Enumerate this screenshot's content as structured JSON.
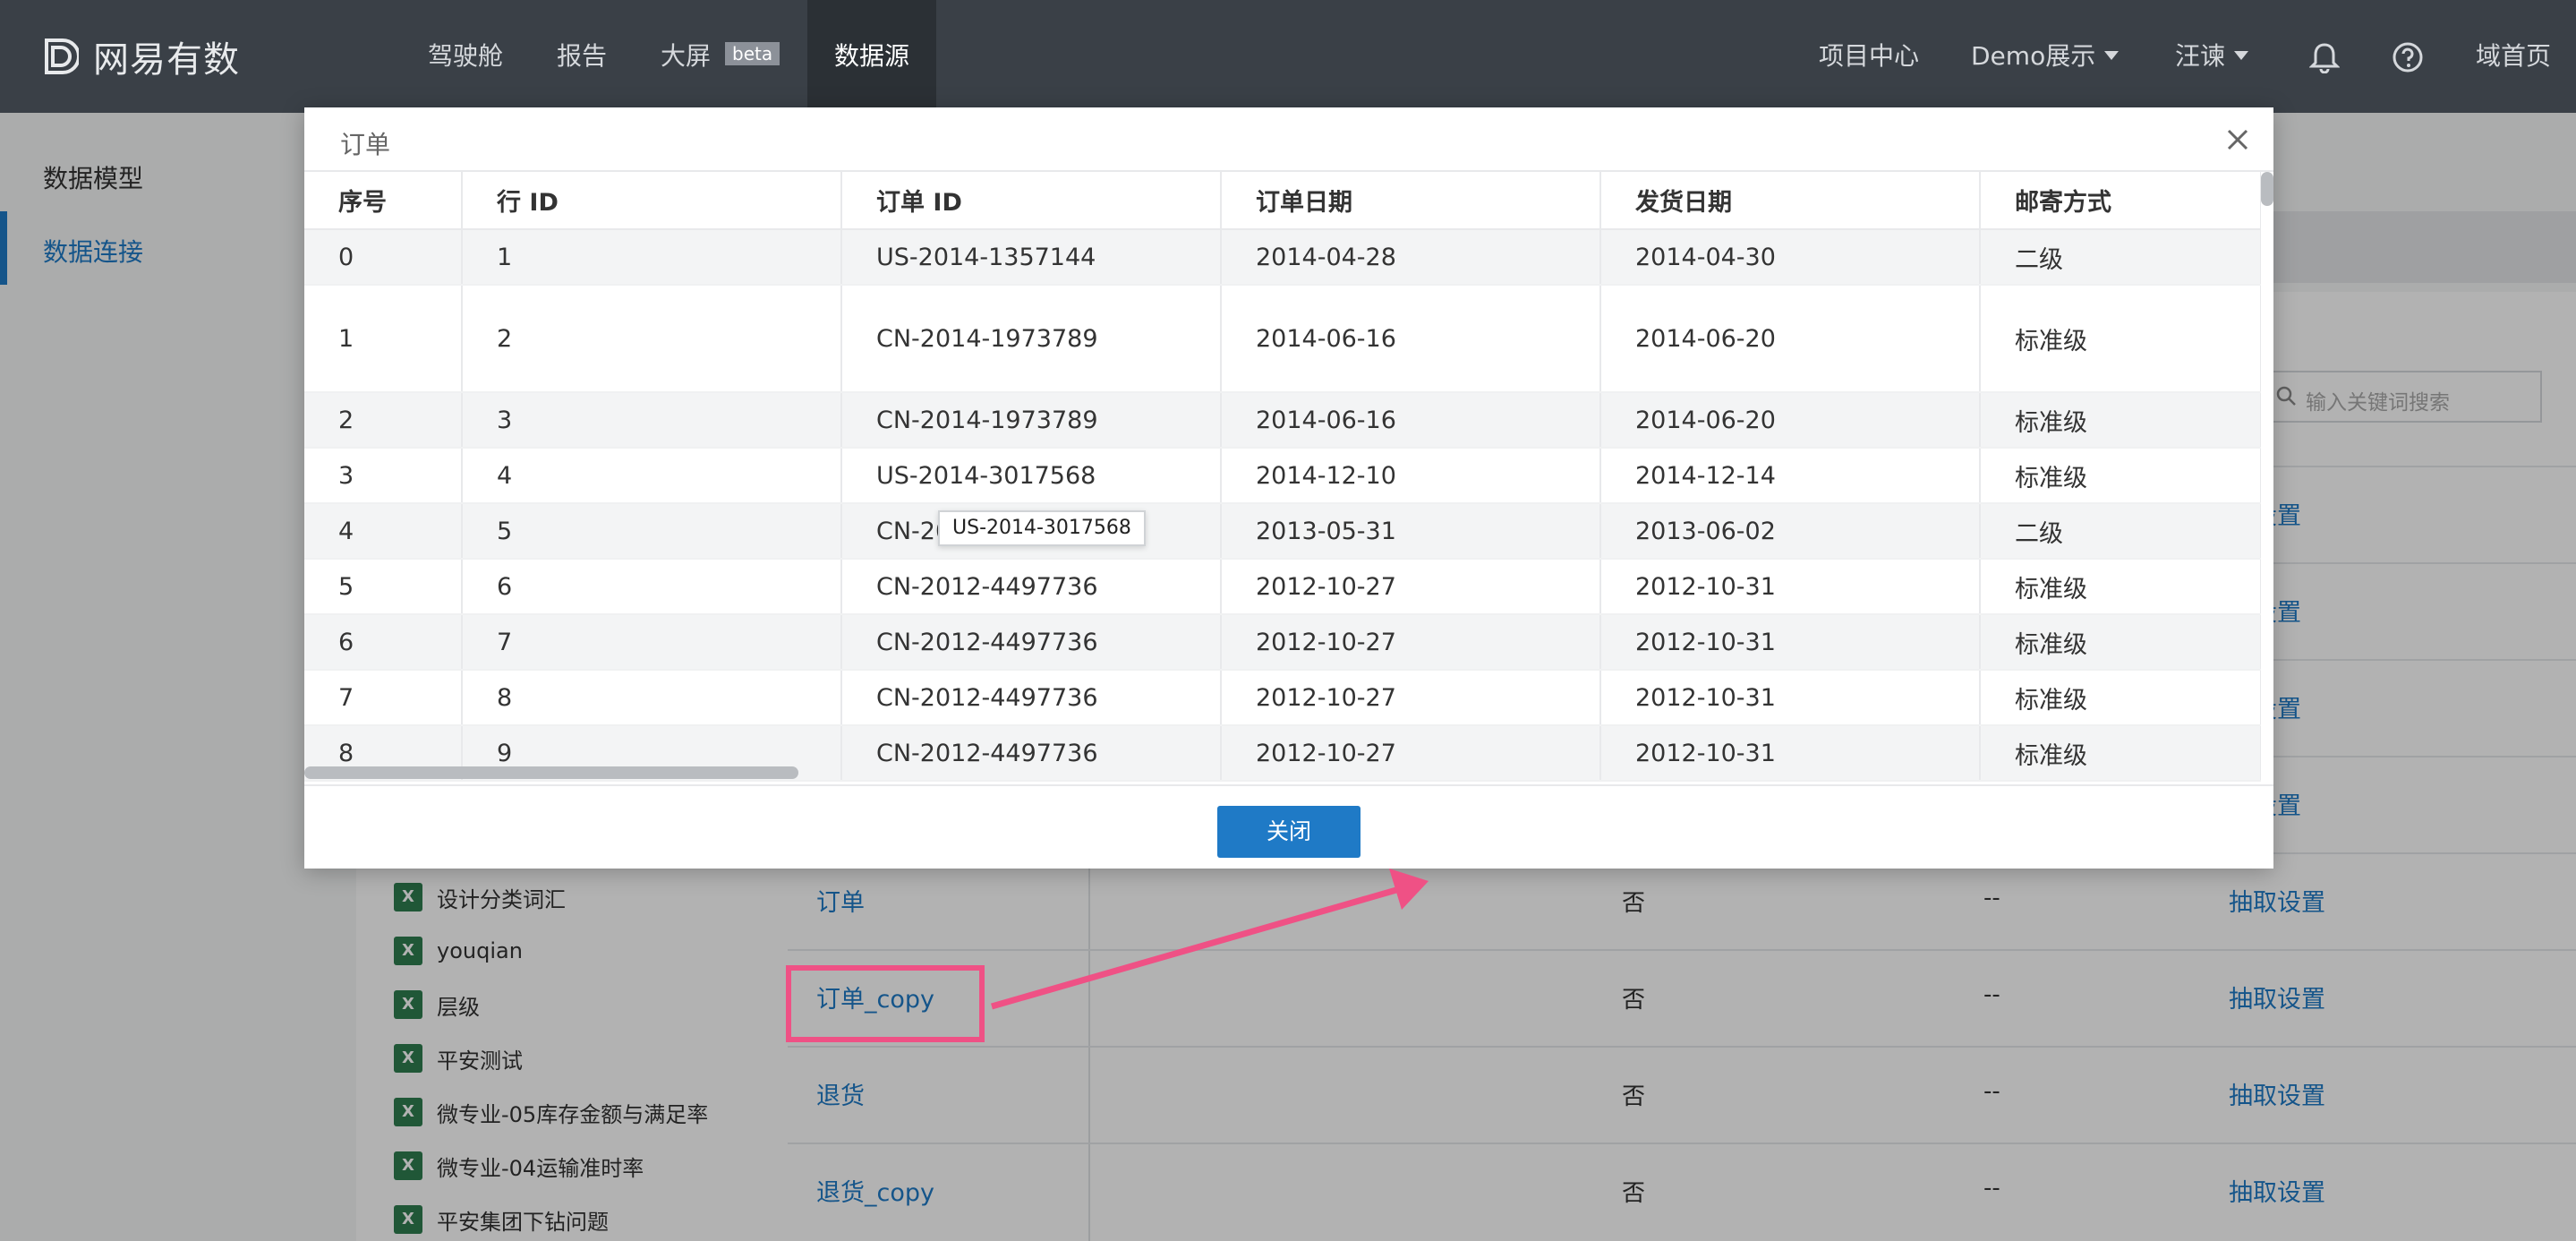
{
  "app": {
    "logo_text": "网易有数"
  },
  "nav": {
    "items": [
      "驾驶舱",
      "报告",
      "大屏",
      "数据源"
    ],
    "beta": "beta",
    "project_center": "项目中心",
    "demo": "Demo展示",
    "user": "汪谏",
    "home": "域首页"
  },
  "sidebar": {
    "items": [
      "数据模型",
      "数据连接"
    ]
  },
  "background": {
    "search_placeholder": "输入关键词搜索",
    "files": [
      "设计分类词汇",
      "youqian",
      "层级",
      "平安测试",
      "微专业-05库存金额与满足率",
      "微专业-04运输准时率",
      "平安集团下钻问题"
    ],
    "rows": [
      {
        "name": "",
        "flag": "",
        "dash": "",
        "action": "取设置"
      },
      {
        "name": "",
        "flag": "",
        "dash": "",
        "action": "取设置"
      },
      {
        "name": "",
        "flag": "",
        "dash": "",
        "action": "取设置"
      },
      {
        "name": "",
        "flag": "",
        "dash": "",
        "action": "取设置"
      },
      {
        "name": "订单",
        "flag": "否",
        "dash": "--",
        "action": "抽取设置"
      },
      {
        "name": "订单_copy",
        "flag": "否",
        "dash": "--",
        "action": "抽取设置"
      },
      {
        "name": "退货",
        "flag": "否",
        "dash": "--",
        "action": "抽取设置"
      },
      {
        "name": "退货_copy",
        "flag": "否",
        "dash": "--",
        "action": "抽取设置"
      }
    ]
  },
  "modal": {
    "title": "订单",
    "columns": [
      "序号",
      "行 ID",
      "订单 ID",
      "订单日期",
      "发货日期",
      "邮寄方式"
    ],
    "rows": [
      [
        "0",
        "1",
        "US-2014-1357144",
        "2014-04-28",
        "2014-04-30",
        "二级"
      ],
      [
        "1",
        "2",
        "CN-2014-1973789",
        "2014-06-16",
        "2014-06-20",
        "标准级"
      ],
      [
        "2",
        "3",
        "CN-2014-1973789",
        "2014-06-16",
        "2014-06-20",
        "标准级"
      ],
      [
        "3",
        "4",
        "US-2014-3017568",
        "2014-12-10",
        "2014-12-14",
        "标准级"
      ],
      [
        "4",
        "5",
        "CN-20",
        "2013-05-31",
        "2013-06-02",
        "二级"
      ],
      [
        "5",
        "6",
        "CN-2012-4497736",
        "2012-10-27",
        "2012-10-31",
        "标准级"
      ],
      [
        "6",
        "7",
        "CN-2012-4497736",
        "2012-10-27",
        "2012-10-31",
        "标准级"
      ],
      [
        "7",
        "8",
        "CN-2012-4497736",
        "2012-10-27",
        "2012-10-31",
        "标准级"
      ],
      [
        "8",
        "9",
        "CN-2012-4497736",
        "2012-10-27",
        "2012-10-31",
        "标准级"
      ]
    ],
    "tooltip": "US-2014-3017568",
    "close_label": "关闭"
  },
  "colors": {
    "accent": "#1f7ac6",
    "topbar": "#3a4047",
    "highlight": "#ef5185"
  }
}
